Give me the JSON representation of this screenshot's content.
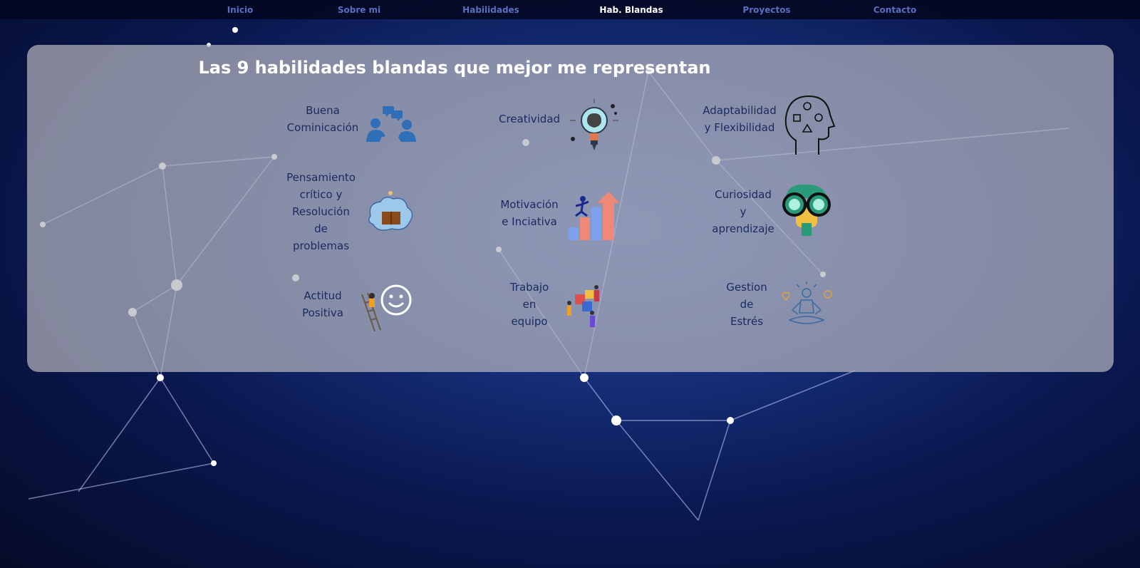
{
  "nav": {
    "items": [
      {
        "label": "Inicio",
        "active": false
      },
      {
        "label": "Sobre mi",
        "active": false
      },
      {
        "label": "Habilidades",
        "active": false
      },
      {
        "label": "Hab. Blandas",
        "active": true
      },
      {
        "label": "Proyectos",
        "active": false
      },
      {
        "label": "Contacto",
        "active": false
      }
    ]
  },
  "main": {
    "title": "Las 9 habilidades blandas que mejor me representan",
    "skills": [
      {
        "lines": [
          "Buena",
          "Cominicación"
        ],
        "icon": "communication-icon"
      },
      {
        "lines": [
          "Creatividad"
        ],
        "icon": "creativity-brain-bulb-icon"
      },
      {
        "lines": [
          "Adaptabilidad",
          "y Flexibilidad"
        ],
        "icon": "head-shapes-icon"
      },
      {
        "lines": [
          "Pensamiento",
          "crítico y",
          "Resolución",
          "de",
          "problemas"
        ],
        "icon": "brain-book-icon"
      },
      {
        "lines": [
          "Motivación",
          "e Inciativa"
        ],
        "icon": "growth-arrow-icon"
      },
      {
        "lines": [
          "Curiosidad",
          "y",
          "aprendizaje"
        ],
        "icon": "binoculars-icon"
      },
      {
        "lines": [
          "Actitud",
          "Positiva"
        ],
        "icon": "smiley-ladder-icon"
      },
      {
        "lines": [
          "Trabajo",
          "en",
          "equipo"
        ],
        "icon": "teamwork-puzzle-icon"
      },
      {
        "lines": [
          "Gestion",
          "de",
          "Estrés"
        ],
        "icon": "meditation-icon"
      }
    ]
  },
  "colors": {
    "nav_text": "#5a6fc0",
    "nav_active": "#ffffff",
    "skill_text": "#1a2a5e",
    "panel": "rgba(180,180,190,0.72)"
  }
}
